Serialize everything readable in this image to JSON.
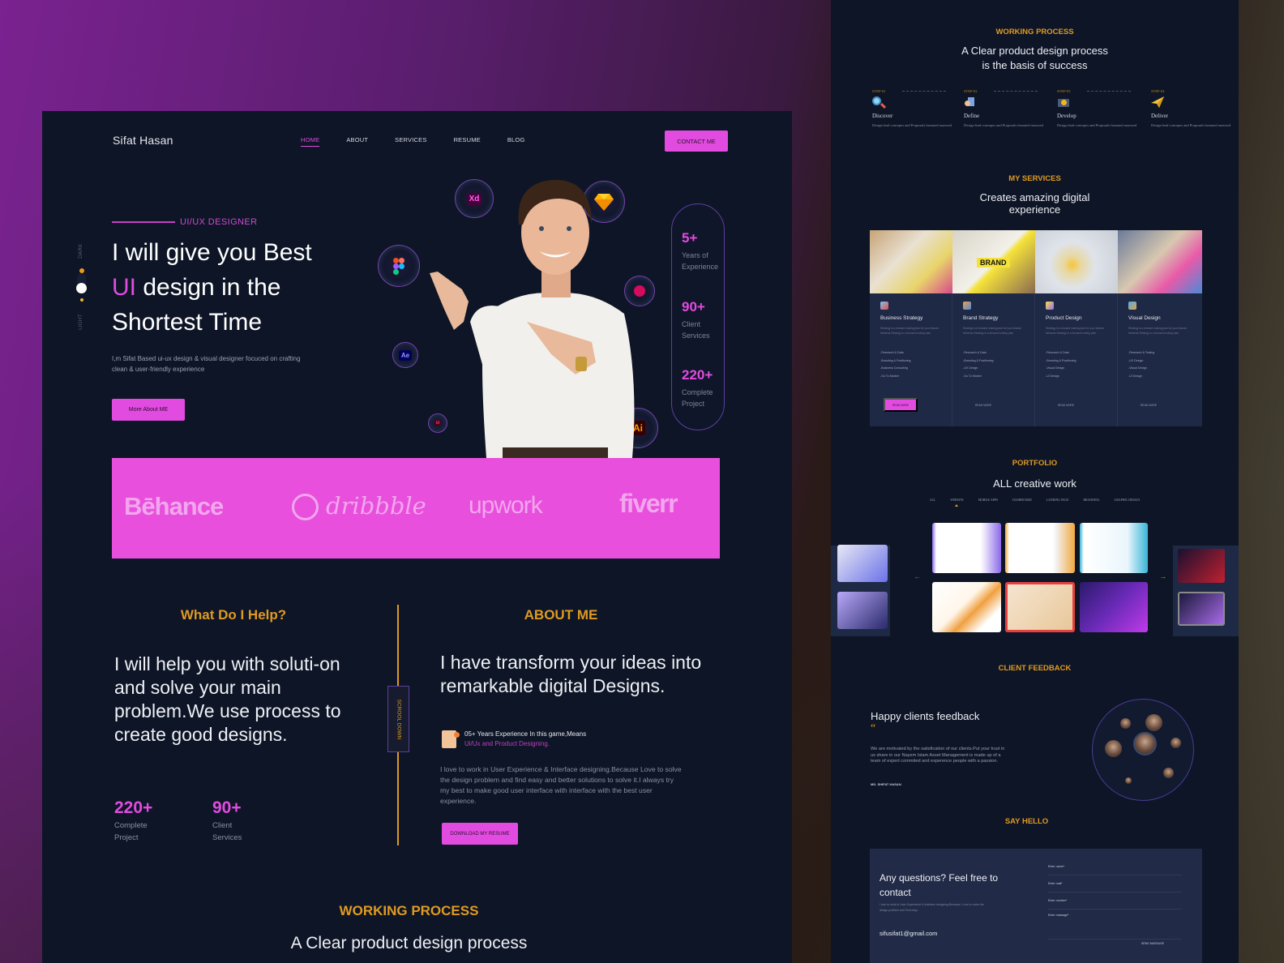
{
  "left_page": {
    "logo": "Sifat Hasan",
    "nav": [
      "HOME",
      "ABOUT",
      "SERVICES",
      "RESUME",
      "BLOG"
    ],
    "nav_active": "HOME",
    "contact_button": "CONTACT ME",
    "theme_toggle": {
      "dark_label": "DARK",
      "light_label": "LIGHT"
    },
    "hero": {
      "tag": "UI/UX DESIGNER",
      "title_line1": "I will give you Best",
      "title_highlight": "UI",
      "title_line2_rest": " design in the",
      "title_line3": "Shortest Time",
      "description": "I,m Sifat Based ui-ux design & visual designer focuced on crafting clean & user-friendly experience",
      "button": "More About ME",
      "tool_icons": [
        "Xd",
        "Sketch",
        "Figma",
        "Ae",
        "Elementor",
        "Id",
        "Ai"
      ]
    },
    "stats": [
      {
        "value": "5+",
        "label": "Years of Experience"
      },
      {
        "value": "90+",
        "label": "Client Services"
      },
      {
        "value": "220+",
        "label": "Complete Project"
      }
    ],
    "brands": [
      "Bēhance",
      "dribbble",
      "upwork",
      "fiverr"
    ],
    "help": {
      "heading": "What Do I Help?",
      "text": "I will help you with soluti-on and solve your main problem.We use process to create good designs.",
      "stats": [
        {
          "value": "220+",
          "label": "Complete Project"
        },
        {
          "value": "90+",
          "label": "Client Services"
        }
      ]
    },
    "scroll_label": "SCROOL DOWN",
    "about": {
      "heading": "ABOUT ME",
      "title": "I have transform your ideas into remarkable digital Designs.",
      "experience_line1": "05+ Years Experience In this game,Means",
      "experience_line2": "Ui/Ux and Product Designing.",
      "description": "I love to work in User Experience & Interface designing.Because Love to solve the design problem and find easy and better solutions to solve it.I always try my best to make good user interface with interface with the best user experience.",
      "button": "DOWNLOAD MY RESUME"
    },
    "working_process": {
      "heading": "WORKING PROCESS",
      "subtitle": "A Clear product design process"
    }
  },
  "right_page": {
    "working_process": {
      "heading": "WORKING PROCESS",
      "subtitle_line1": "A Clear product design process",
      "subtitle_line2": "is the basis of success",
      "steps": [
        {
          "step": "STEP-01",
          "name": "Discover",
          "desc": "Design lead concepes and Proposals hearated assessed",
          "icon": "magnifier-icon"
        },
        {
          "step": "STEP-02",
          "name": "Define",
          "desc": "Design lead concepes and Proposals hearated assessed",
          "icon": "document-icon"
        },
        {
          "step": "STEP-03",
          "name": "Develop",
          "desc": "Design lead concepes and Proposals hearated assessed",
          "icon": "monitor-gear-icon"
        },
        {
          "step": "STEP-04",
          "name": "Deliver",
          "desc": "Design lead concepes and Proposals hearated assessed",
          "icon": "paper-plane-icon"
        }
      ]
    },
    "services": {
      "heading": "MY SERVICES",
      "subtitle_line1": "Creates amazing digital",
      "subtitle_line2": "experience",
      "items": [
        {
          "name": "Business Strategy",
          "desc": "Strategy is a forward looking plan for your brands behavior.Strategy is a forward looking plan",
          "bullets": [
            "-Research & Data",
            "-Branding & Positioning",
            "-Business Consulting",
            "-Go To Market"
          ],
          "button": "READ MORE",
          "active": true
        },
        {
          "name": "Brand Strategy",
          "desc": "Strategy is a forward looking plan for your brands behavior.Strategy is a forward looking plan",
          "bullets": [
            "-Research & Data",
            "-Branding & Positioning",
            "-UX Design",
            "-Go To Market"
          ],
          "button": "READ MORE",
          "active": false
        },
        {
          "name": "Product Design",
          "desc": "Strategy is a forward looking plan for your brands behavior.Strategy is a forward looking plan",
          "bullets": [
            "-Research & Data",
            "-Branding & Positioning",
            "-Visual Design",
            "-UI Design"
          ],
          "button": "READ MORE",
          "active": false
        },
        {
          "name": "Visual Design",
          "desc": "Strategy is a forward looking plan for your brands behavior.Strategy is a forward looking plan",
          "bullets": [
            "-Research & Testing",
            "-UX Design",
            "-Visual Design",
            "-UI Design"
          ],
          "button": "READ MORE",
          "active": false
        }
      ]
    },
    "portfolio": {
      "heading": "PORTFOLIO",
      "subtitle": "ALL creative work",
      "tabs": [
        "ALL",
        "WEBSITE",
        "MOBILE APPS",
        "DASHBOARD",
        "LANDING PAGE",
        "BRANDING",
        "GRAPHIC DESIGN"
      ],
      "active_tab": "WEBSITE",
      "prev_arrow": "←",
      "next_arrow": "→"
    },
    "feedback": {
      "heading": "CLIENT FEEDBACK",
      "title": "Happy clients feedback",
      "quote_mark": "“",
      "text": "We are motivated by the satisfication of our clients.Put your trust in us share in our Nayem Islam Asset Management is made up of a team of expert commited and experence people with a passion.",
      "author": "MD. SHIFAT HASAN"
    },
    "contact": {
      "heading": "SAY HELLO",
      "title": "Any questions? Feel free to contact",
      "desc": "I love to work in User Experience & Interface designing.Because I Love to solve the design problem and Find easy.",
      "email": "sifusifat1@gmail.com",
      "fields": [
        "Enter name*",
        "Enter mail*",
        "Enter number*",
        "Enter massage*"
      ],
      "send_button": "SEND MASSAGE"
    }
  },
  "colors": {
    "accent": "#e24be0",
    "gold": "#e09a22",
    "page_bg": "#0d1526",
    "card_bg": "#1e2946"
  }
}
